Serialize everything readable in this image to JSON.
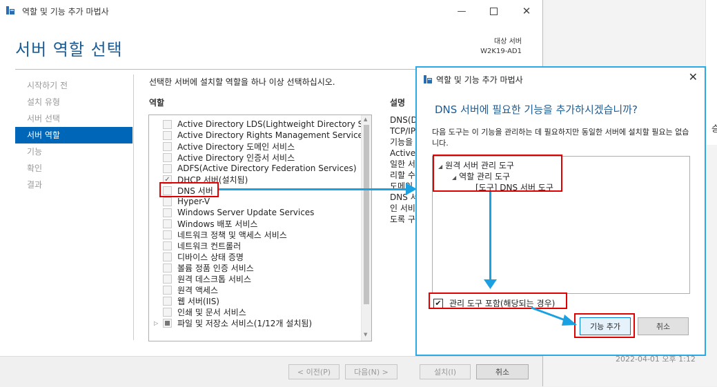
{
  "window": {
    "title": "역할 및 기능 추가 마법사",
    "minimize_icon": "minimize-icon",
    "maximize_icon": "maximize-icon",
    "close_icon": "close-icon"
  },
  "header": {
    "page_title": "서버 역할 선택",
    "target_label": "대상 서버",
    "target_server": "W2K19-AD1"
  },
  "nav": {
    "items": [
      {
        "label": "시작하기 전",
        "active": false
      },
      {
        "label": "설치 유형",
        "active": false
      },
      {
        "label": "서버 선택",
        "active": false
      },
      {
        "label": "서버 역할",
        "active": true
      },
      {
        "label": "기능",
        "active": false
      },
      {
        "label": "확인",
        "active": false
      },
      {
        "label": "결과",
        "active": false
      }
    ]
  },
  "content": {
    "instruction": "선택한 서버에 설치할 역할을 하나 이상 선택하십시오.",
    "roles_label": "역할",
    "description_label": "설명",
    "roles": [
      {
        "label": "Active Directory LDS(Lightweight Directory Services)",
        "state": "unchecked"
      },
      {
        "label": "Active Directory Rights Management Services",
        "state": "unchecked"
      },
      {
        "label": "Active Directory 도메인 서비스",
        "state": "unchecked"
      },
      {
        "label": "Active Directory 인증서 서비스",
        "state": "unchecked"
      },
      {
        "label": "ADFS(Active Directory Federation Services)",
        "state": "unchecked"
      },
      {
        "label": "DHCP 서버(설치됨)",
        "state": "checked-disabled"
      },
      {
        "label": "DNS 서버",
        "state": "unchecked"
      },
      {
        "label": "Hyper-V",
        "state": "unchecked"
      },
      {
        "label": "Windows Server Update Services",
        "state": "unchecked"
      },
      {
        "label": "Windows 배포 서비스",
        "state": "unchecked"
      },
      {
        "label": "네트워크 정책 및 액세스 서비스",
        "state": "unchecked"
      },
      {
        "label": "네트워크 컨트롤러",
        "state": "unchecked"
      },
      {
        "label": "디바이스 상태 증명",
        "state": "unchecked"
      },
      {
        "label": "볼륨 정품 인증 서비스",
        "state": "unchecked"
      },
      {
        "label": "원격 데스크톱 서비스",
        "state": "unchecked"
      },
      {
        "label": "원격 액세스",
        "state": "unchecked"
      },
      {
        "label": "웹 서버(IIS)",
        "state": "unchecked"
      },
      {
        "label": "인쇄 및 문서 서비스",
        "state": "unchecked"
      },
      {
        "label": "파일 및 저장소 서비스(1/12개 설치됨)",
        "state": "partial"
      }
    ],
    "description_lines": [
      "DNS(Do",
      "TCP/IP",
      "기능을",
      "Active D",
      "일한 서",
      "리할 수",
      "도메인",
      "DNS 서",
      "인 서비",
      "도록 구"
    ]
  },
  "footer": {
    "prev": "< 이전(P)",
    "next": "다음(N) >",
    "install": "설치(I)",
    "cancel": "취소"
  },
  "dialog": {
    "title": "역할 및 기능 추가 마법사",
    "close_icon": "close-icon",
    "heading": "DNS 서버에 필요한 기능을 추가하시겠습니까?",
    "text": "다음 도구는 이 기능을 관리하는 데 필요하지만 동일한 서버에 설치할 필요는 없습니다.",
    "tree": [
      {
        "label": "원격 서버 관리 도구",
        "level": 0,
        "expander": true
      },
      {
        "label": "역할 관리 도구",
        "level": 1,
        "expander": true
      },
      {
        "label": "[도구] DNS 서버 도구",
        "level": 2,
        "expander": false
      }
    ],
    "include_tools_label": "관리 도구 포함(해당되는 경우)",
    "include_tools_checked": true,
    "add_button": "기능 추가",
    "cancel_button": "취소"
  },
  "background": {
    "glyph": "승",
    "timestamp": "2022-04-01 오후 1:12"
  }
}
